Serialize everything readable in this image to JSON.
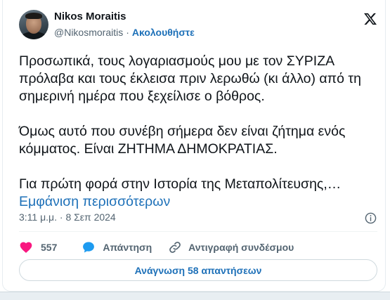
{
  "author": {
    "name": "Nikos Moraitis",
    "handle": "@Nikosmoraitis",
    "separator": "·",
    "follow_label": "Ακολουθήστε"
  },
  "tweet": {
    "paragraph_1": "Προσωπικά, τους λογαριασμούς μου με τον ΣΥΡΙΖΑ πρόλαβα και τους έκλεισα πριν λερωθώ (κι άλλο) από τη σημερινή ημέρα που ξεχείλισε ο βόθρος.",
    "paragraph_2": "Όμως αυτό που συνέβη σήμερα δεν είναι ζήτημα ενός κόμματος. Είναι ΖΗΤΗΜΑ ΔΗΜΟΚΡΑΤΙΑΣ.",
    "paragraph_3": "Για πρώτη φορά στην Ιστορία της Μεταπολίτευσης,…",
    "show_more": "Εμφάνιση περισσότερων",
    "timestamp": "3:11 μ.μ. · 8 Σεπ 2024"
  },
  "actions": {
    "like_count": "557",
    "reply_label": "Απάντηση",
    "copy_link_label": "Αντιγραφή συνδέσμου"
  },
  "footer": {
    "read_replies_label": "Ανάγνωση 58 απαντήσεων"
  },
  "colors": {
    "like": "#f91880",
    "reply": "#1d9bf0",
    "link": "#1d70b8",
    "secondary_text": "#536471"
  },
  "icons": {
    "brand": "x-logo-icon",
    "info": "info-icon",
    "like": "heart-icon",
    "reply": "speech-bubble-icon",
    "copy": "link-icon"
  }
}
